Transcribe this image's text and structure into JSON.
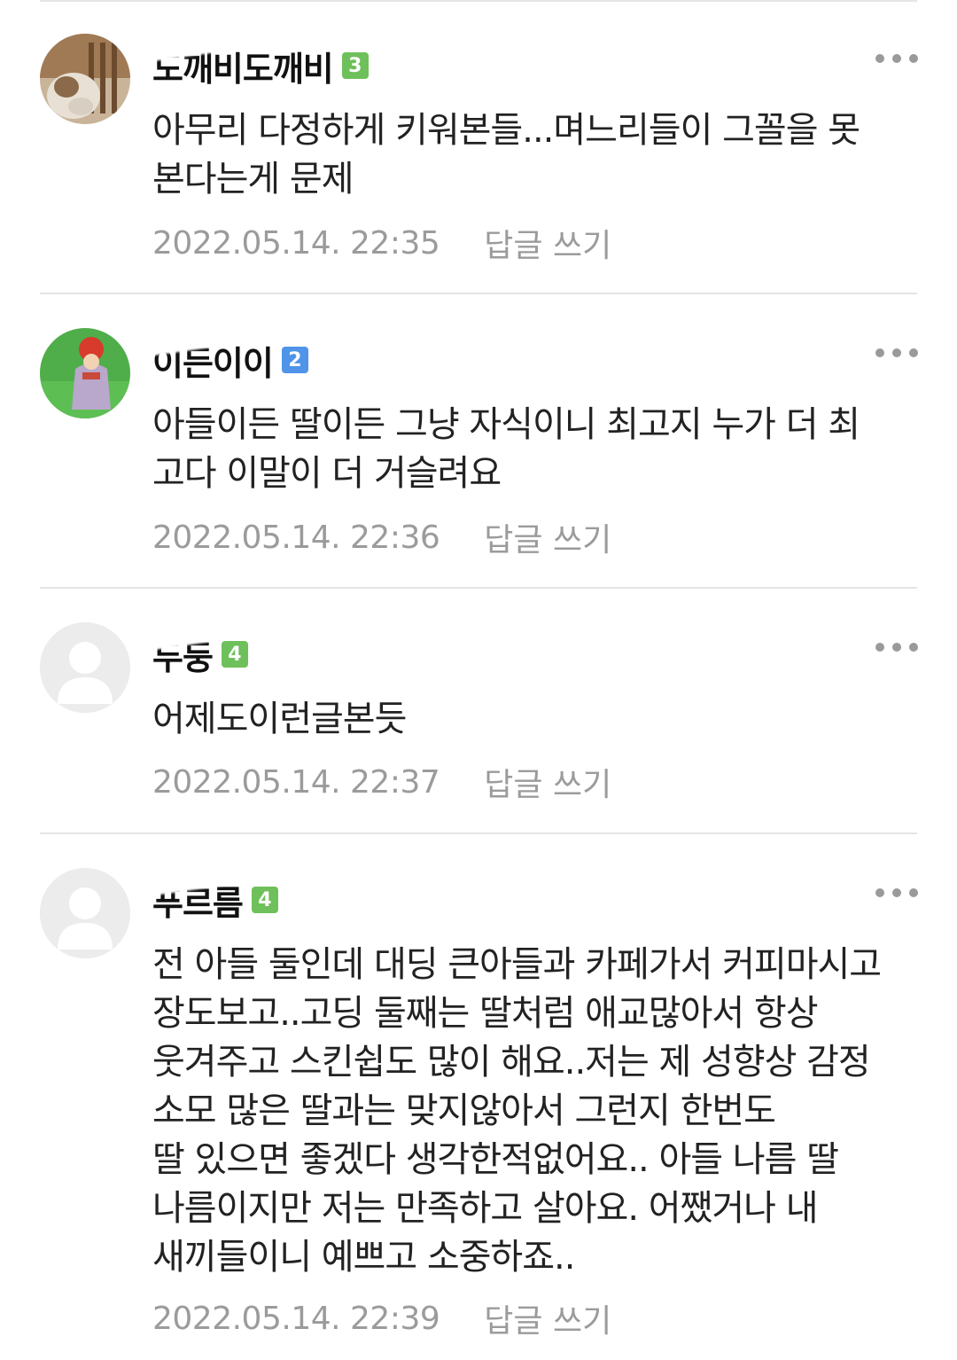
{
  "comments": [
    {
      "nickname": "도깨비도깨비",
      "level": "3",
      "level_color": "#6ec05a",
      "text": "아무리 다정하게 키워본들...며느리들이 그꼴을 못\n본다는게 문제",
      "timestamp": "2022.05.14. 22:35",
      "reply_label": "답글 쓰기",
      "avatar": "cat-photo"
    },
    {
      "nickname": "이든이이",
      "level": "2",
      "level_color": "#4f94e8",
      "text": "아들이든 딸이든 그냥 자식이니 최고지 누가 더 최\n고다 이말이 더 거슬려요",
      "timestamp": "2022.05.14. 22:36",
      "reply_label": "답글 쓰기",
      "avatar": "girl-illustration"
    },
    {
      "nickname": "두둥",
      "level": "4",
      "level_color": "#6ec05a",
      "text": "어제도이런글본듯",
      "timestamp": "2022.05.14. 22:37",
      "reply_label": "답글 쓰기",
      "avatar": "default-profile"
    },
    {
      "nickname": "푸르름",
      "level": "4",
      "level_color": "#6ec05a",
      "text": "전 아들 둘인데 대딩 큰아들과 카페가서 커피마시고\n장도보고..고딩 둘째는 딸처럼 애교많아서 항상\n웃겨주고 스킨쉽도 많이 해요..저는 제 성향상 감정\n소모 많은 딸과는 맞지않아서 그런지 한번도\n딸 있으면 좋겠다 생각한적없어요.. 아들 나름 딸\n나름이지만 저는 만족하고 살아요. 어쨌거나 내\n새끼들이니 예쁘고 소중하죠..",
      "timestamp": "2022.05.14. 22:39",
      "reply_label": "답글 쓰기",
      "avatar": "default-profile"
    }
  ]
}
